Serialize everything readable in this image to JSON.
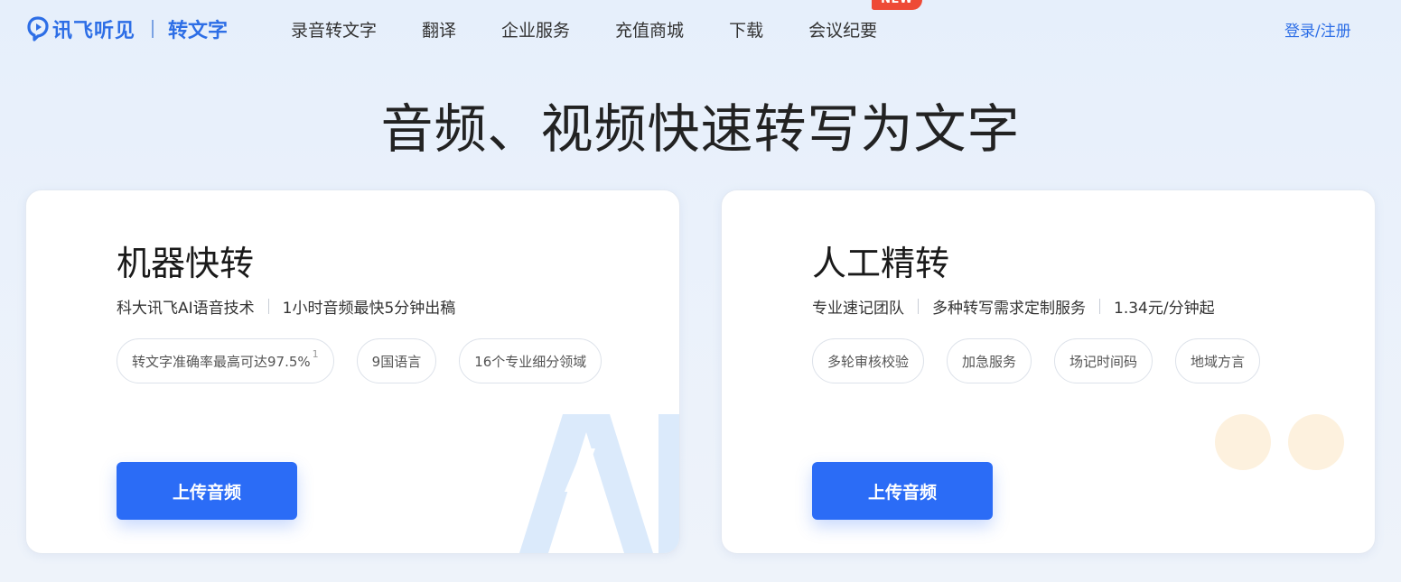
{
  "header": {
    "logo_text": "讯飞听见",
    "product": "转文字",
    "nav": [
      {
        "label": "录音转文字"
      },
      {
        "label": "翻译"
      },
      {
        "label": "企业服务"
      },
      {
        "label": "充值商城"
      },
      {
        "label": "下载"
      },
      {
        "label": "会议纪要",
        "badge": "NEW"
      }
    ],
    "login": "登录/注册"
  },
  "hero": {
    "title": "音频、视频快速转写为文字"
  },
  "cards": [
    {
      "title": "机器快转",
      "subtitle": [
        "科大讯飞AI语音技术",
        "1小时音频最快5分钟出稿"
      ],
      "tags": [
        {
          "label": "转文字准确率最高可达97.5%",
          "sup": "1"
        },
        {
          "label": "9国语言"
        },
        {
          "label": "16个专业细分领域"
        }
      ],
      "button": "上传音频",
      "decoration_icon": "ai-lightning-icon"
    },
    {
      "title": "人工精转",
      "subtitle": [
        "专业速记团队",
        "多种转写需求定制服务",
        "1.34元/分钟起"
      ],
      "tags": [
        {
          "label": "多轮审核校验"
        },
        {
          "label": "加急服务"
        },
        {
          "label": "场记时间码"
        },
        {
          "label": "地域方言"
        }
      ],
      "button": "上传音频",
      "decoration_icon": "dots-icon"
    }
  ],
  "colors": {
    "brand": "#2d6ee6",
    "button": "#2b6cf6",
    "badge": "#ee4a36"
  }
}
